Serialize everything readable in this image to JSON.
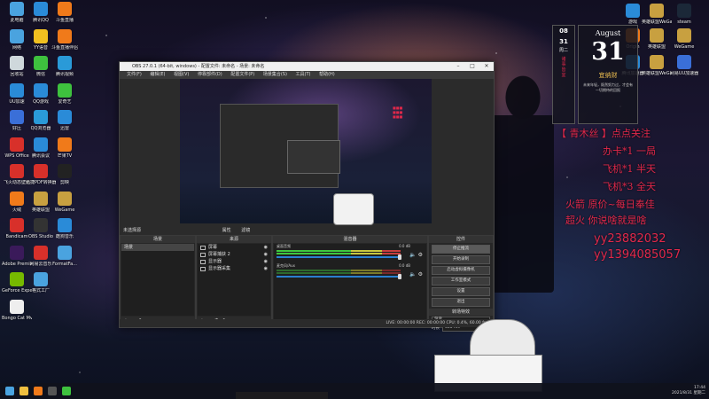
{
  "desktop_left_icons": [
    {
      "label": "此电脑",
      "color": "#4aa3df"
    },
    {
      "label": "腾讯QQ",
      "color": "#2a8bd8"
    },
    {
      "label": "斗鱼直播",
      "color": "#f07a1a"
    },
    {
      "label": "网络",
      "color": "#4aa3df"
    },
    {
      "label": "YY语音",
      "color": "#f0c020"
    },
    {
      "label": "斗鱼直播伴侣",
      "color": "#f07a1a"
    },
    {
      "label": "回收站",
      "color": "#cfd8dc"
    },
    {
      "label": "微信",
      "color": "#3ec13e"
    },
    {
      "label": "腾讯视频",
      "color": "#2a9ad8"
    },
    {
      "label": "UU加速",
      "color": "#2a8bd8"
    },
    {
      "label": "QQ游戏",
      "color": "#2a8bd8"
    },
    {
      "label": "爱奇艺",
      "color": "#3ec13e"
    },
    {
      "label": "好压",
      "color": "#3a6fd8"
    },
    {
      "label": "QQ浏览器",
      "color": "#2a9ad8"
    },
    {
      "label": "迅雷",
      "color": "#2a8bd8"
    },
    {
      "label": "WPS Office",
      "color": "#d8302a"
    },
    {
      "label": "腾讯会议",
      "color": "#2a8bd8"
    },
    {
      "label": "芒果TV",
      "color": "#f07a1a"
    },
    {
      "label": "飞火动态壁纸",
      "color": "#d8302a"
    },
    {
      "label": "迅捷PDF转换器",
      "color": "#d8302a"
    },
    {
      "label": "剪映",
      "color": "#222222"
    },
    {
      "label": "火绒",
      "color": "#f07a1a"
    },
    {
      "label": "英雄联盟",
      "color": "#c8a040"
    },
    {
      "label": "WeGame",
      "color": "#c8a040"
    },
    {
      "label": "Bandicam",
      "color": "#d8302a"
    },
    {
      "label": "OBS Studio",
      "color": "#333333"
    },
    {
      "label": "酷狗音乐",
      "color": "#2a8bd8"
    },
    {
      "label": "Adobe Premiere...",
      "color": "#3a1a5a"
    },
    {
      "label": "网易云音乐",
      "color": "#d8302a"
    },
    {
      "label": "FormatFa...",
      "color": "#4aa3df"
    },
    {
      "label": "GeForce Experience",
      "color": "#76b900"
    },
    {
      "label": "格式工厂",
      "color": "#4aa3df"
    },
    {
      "label": "Bongo Cat Mver.exe",
      "color": "#eeeeee"
    }
  ],
  "desktop_right_icons": [
    {
      "label": "游戏",
      "color": "#2a8bd8"
    },
    {
      "label": "英雄联盟WeGame",
      "color": "#c8a040"
    },
    {
      "label": "steam",
      "color": "#1b2838"
    },
    {
      "label": "Origin",
      "color": "#f07a1a"
    },
    {
      "label": "英雄联盟",
      "color": "#c8a040"
    },
    {
      "label": "WeGame",
      "color": "#c8a040"
    },
    {
      "label": "英雄联盟WeGame...",
      "color": "#c8a040"
    },
    {
      "label": "腾讯加速器",
      "color": "#2a8bd8"
    },
    {
      "label": "网易UU加速器",
      "color": "#3a6fd8"
    }
  ],
  "obs": {
    "title": "OBS 27.0.1 (64-bit, windows) - 配置文件: 未命名 - 场景: 未命名",
    "menu": [
      "文件(F)",
      "编辑(E)",
      "视图(V)",
      "停靠部件(D)",
      "配置文件(P)",
      "场景集合(S)",
      "工具(T)",
      "帮助(H)"
    ],
    "scene_bar_label": "未选择源",
    "scene_bar_mid": [
      "属性",
      "滤镜"
    ],
    "docks": {
      "scenes": {
        "title": "场景",
        "items": [
          "场景"
        ]
      },
      "sources": {
        "title": "来源",
        "items": [
          "屏幕",
          "屏幕捕获 2",
          "显示器",
          "显示器采集"
        ]
      },
      "mixer": {
        "title": "混音器",
        "channels": [
          {
            "name": "桌面音频",
            "level": "0.0 dB"
          },
          {
            "name": "麦克风/Aux",
            "level": "0.0 dB"
          }
        ]
      },
      "transitions": {
        "title": "转场特效",
        "type": "渐变",
        "duration_label": "时长",
        "duration": "300 ms"
      },
      "controls": {
        "title": "控件",
        "buttons": [
          "停止推流",
          "开始录制",
          "启动虚拟摄像机",
          "工作室模式",
          "设置",
          "退出"
        ]
      }
    },
    "status": "LIVE: 00:00:00   REC: 00:00:00   CPU: 0.4%, 60.00 fps"
  },
  "calendar": {
    "month_num": "08",
    "day_small": "31",
    "weekday": "周二",
    "vertical_text": "诸事皆宜",
    "month": "August",
    "day": "31",
    "good_fortune": "宜纳财",
    "quote": "未来年轻，既然努力过，才会有一切期待的回报"
  },
  "overlay": {
    "line1": "【 青木丝 】点点关注",
    "line2": "办卡*1  一局",
    "line3": "飞机*1  半天",
    "line4": "飞机*3  全天",
    "line5": "火箭  原价~每日奉佳",
    "line6": "超火  你说啥就是啥",
    "yy1": "yy23882032",
    "yy2": "yy1394085057"
  },
  "taskbar": {
    "time": "17:44",
    "date": "2021/8/31 星期二",
    "apps": [
      {
        "name": "windows-start",
        "color": "#4aa3df"
      },
      {
        "name": "file-explorer",
        "color": "#f0c040"
      },
      {
        "name": "douyu",
        "color": "#f07a1a"
      },
      {
        "name": "obs",
        "color": "#555555"
      },
      {
        "name": "wechat",
        "color": "#3ec13e"
      }
    ]
  }
}
